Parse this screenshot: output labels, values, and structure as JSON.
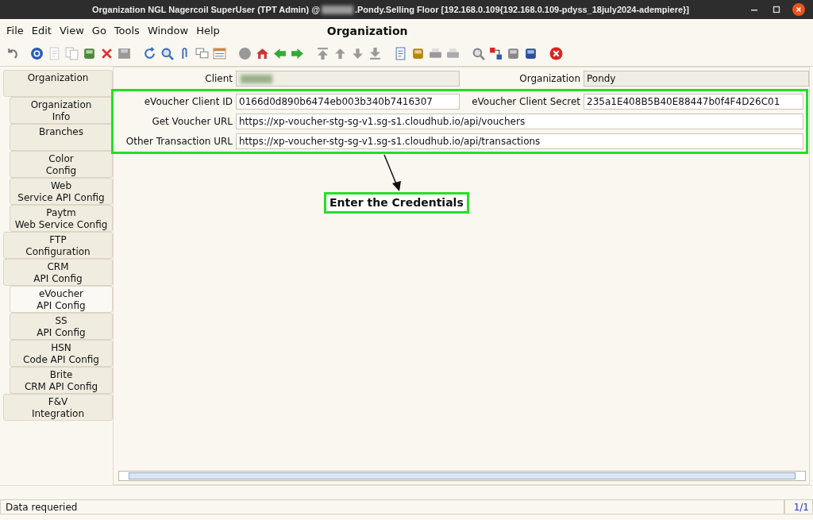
{
  "window": {
    "title_before": "Organization  NGL  Nagercoil  SuperUser (TPT Admin) @",
    "title_after": ".Pondy.Selling Floor [192.168.0.109{192.168.0.109-pdyss_18july2024-adempiere}]"
  },
  "menu": [
    "File",
    "Edit",
    "View",
    "Go",
    "Tools",
    "Window",
    "Help"
  ],
  "heading": "Organization",
  "tabs": [
    {
      "label": "Organization",
      "selected": false,
      "children": [
        {
          "label": "Organization\nInfo",
          "selected": false
        },
        {
          "label": "Branches",
          "selected": false
        },
        {
          "label": "Color\nConfig",
          "selected": false
        },
        {
          "label": "Web\nService API Config",
          "selected": false
        },
        {
          "label": "Paytm\nWeb Service Config",
          "selected": false
        }
      ]
    },
    {
      "label": "FTP\nConfiguration",
      "selected": false
    },
    {
      "label": "CRM\nAPI Config",
      "selected": false,
      "children": [
        {
          "label": "eVoucher\nAPI Config",
          "selected": true
        },
        {
          "label": "SS\nAPI Config",
          "selected": false
        },
        {
          "label": "HSN\nCode API Config",
          "selected": false
        },
        {
          "label": "Brite\nCRM API Config",
          "selected": false
        }
      ]
    },
    {
      "label": "F&V\nIntegration",
      "selected": false
    }
  ],
  "top_fields": [
    {
      "label": "Client",
      "readonly": true,
      "redacted": true
    },
    {
      "label": "Organization",
      "value": "Pondy",
      "readonly": true
    }
  ],
  "credential_fields": [
    {
      "label": "eVoucher Client ID",
      "value": "0166d0d890b6474eb003b340b7416307",
      "readonly": false
    },
    {
      "label": "eVoucher Client Secret",
      "value": "235a1E408B5B40E88447b0f4F4D26C01",
      "readonly": false
    },
    {
      "label": "Get Voucher URL",
      "value": "https://xp-voucher-stg-sg-v1.sg-s1.cloudhub.io/api/vouchers",
      "readonly": false,
      "wide": true
    },
    {
      "label": "Other Transaction URL",
      "value": "https://xp-voucher-stg-sg-v1.sg-s1.cloudhub.io/api/transactions",
      "readonly": false,
      "wide": true
    }
  ],
  "annotation": "Enter the Credentials",
  "status_bar": {
    "message": "Data requeried",
    "record": "1/1"
  }
}
